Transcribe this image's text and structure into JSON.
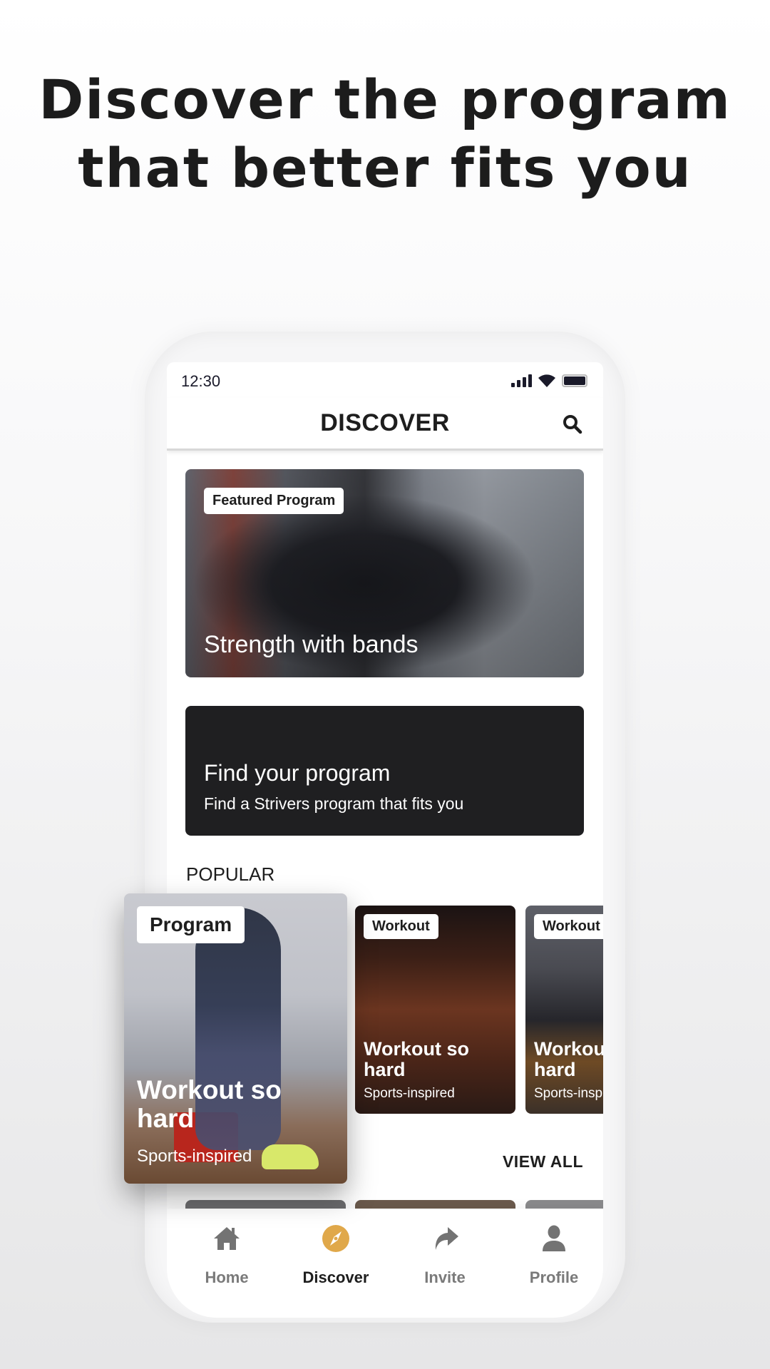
{
  "headline": {
    "line1": "Discover the program",
    "line2": "that better fits you"
  },
  "status_bar": {
    "time": "12:30",
    "icons": [
      "signal-icon",
      "wifi-icon",
      "battery-icon"
    ]
  },
  "header": {
    "title": "DISCOVER",
    "search_icon": "search-icon"
  },
  "featured": {
    "tag": "Featured Program",
    "title": "Strength with bands"
  },
  "find_program": {
    "title": "Find your program",
    "subtitle": "Find a Strivers program that fits you"
  },
  "popular": {
    "section_label": "POPULAR",
    "view_all": "VIEW ALL",
    "cards": [
      {
        "tag": "Program",
        "name_line1": "Workout so",
        "name_line2": "hard",
        "subtitle": "Sports-inspired"
      },
      {
        "tag": "Workout",
        "name_line1": "Workout so",
        "name_line2": "hard",
        "subtitle": "Sports-inspired"
      },
      {
        "tag": "Workout",
        "name_line1": "Workout so",
        "name_line2": "hard",
        "subtitle": "Sports-inspired"
      }
    ]
  },
  "bottom_nav": {
    "active_color": "#e0a84a",
    "items": [
      {
        "label": "Home",
        "icon": "home-icon",
        "active": false
      },
      {
        "label": "Discover",
        "icon": "compass-icon",
        "active": true
      },
      {
        "label": "Invite",
        "icon": "share-arrow-icon",
        "active": false
      },
      {
        "label": "Profile",
        "icon": "user-icon",
        "active": false
      }
    ]
  }
}
